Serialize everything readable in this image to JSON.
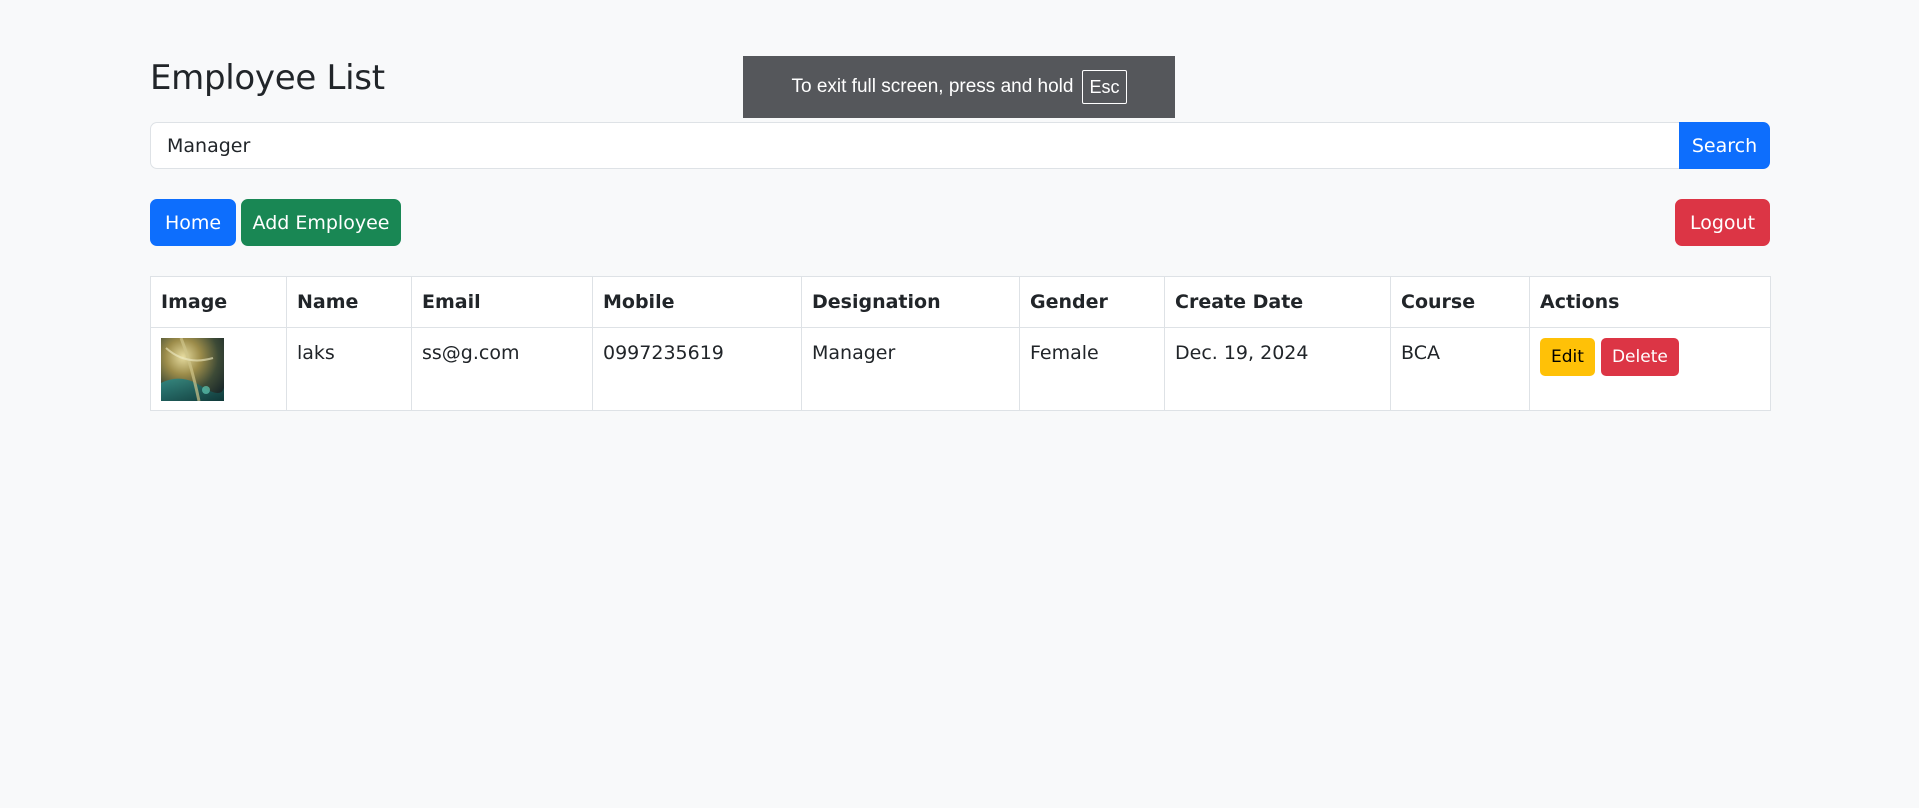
{
  "page": {
    "title": "Employee List"
  },
  "search": {
    "value": "Manager",
    "button_label": "Search"
  },
  "nav": {
    "home_label": "Home",
    "add_label": "Add Employee",
    "logout_label": "Logout"
  },
  "table": {
    "headers": [
      "Image",
      "Name",
      "Email",
      "Mobile",
      "Designation",
      "Gender",
      "Create Date",
      "Course",
      "Actions"
    ],
    "rows": [
      {
        "name": "laks",
        "email": "ss@g.com",
        "mobile": "0997235619",
        "designation": "Manager",
        "gender": "Female",
        "create_date": "Dec. 19, 2024",
        "course": "BCA",
        "edit_label": "Edit",
        "delete_label": "Delete"
      }
    ]
  },
  "fullscreen_notice": {
    "text": "To exit full screen, press and hold",
    "key": "Esc"
  },
  "colors": {
    "primary": "#0d6efd",
    "success": "#198754",
    "danger": "#dc3545",
    "warning": "#ffc107",
    "background": "#f8f9fa"
  }
}
